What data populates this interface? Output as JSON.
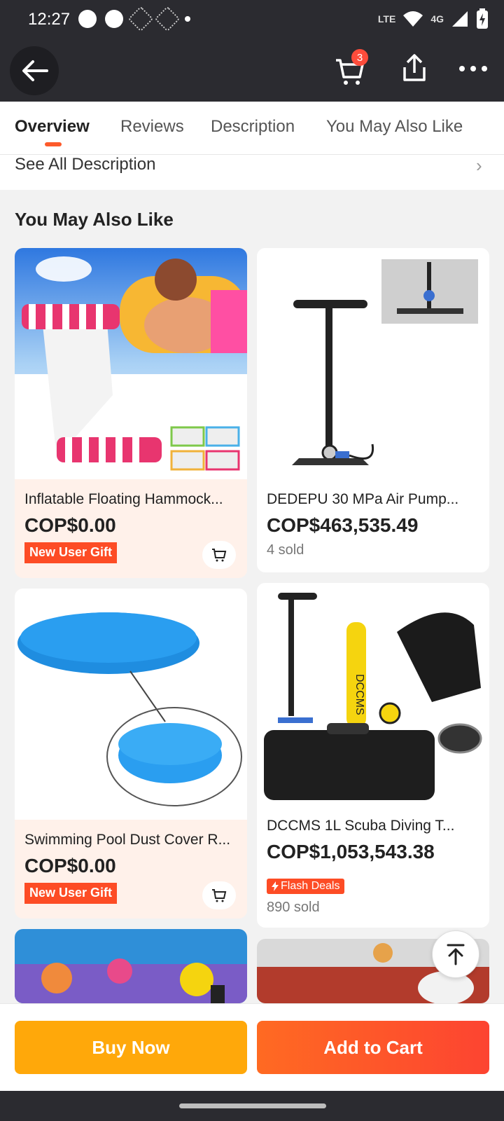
{
  "status_bar": {
    "time": "12:27",
    "network_label": "4G",
    "lte_label": "LTE"
  },
  "header": {
    "cart_count": "3"
  },
  "tabs": [
    {
      "label": "Overview",
      "active": true
    },
    {
      "label": "Reviews",
      "active": false
    },
    {
      "label": "Description",
      "active": false
    },
    {
      "label": "You May Also Like",
      "active": false
    }
  ],
  "see_all": {
    "label": "See All Description",
    "chevron": "›"
  },
  "section": {
    "title": "You May Also Like"
  },
  "products": [
    {
      "title": "Inflatable Floating Hammock...",
      "price": "COP$0.00",
      "badge": "New User Gift"
    },
    {
      "title": "DEDEPU 30 MPa Air Pump...",
      "price": "COP$463,535.49",
      "sold": "4 sold"
    },
    {
      "title": "Swimming Pool Dust Cover R...",
      "price": "COP$0.00",
      "badge": "New User Gift"
    },
    {
      "title": "DCCMS 1L Scuba Diving T...",
      "price": "COP$1,053,543.38",
      "flash": "Flash Deals",
      "sold": "890 sold",
      "brand_text": "DCCMS"
    }
  ],
  "actions": {
    "buy_now": "Buy Now",
    "add_to_cart": "Add to Cart"
  },
  "colors": {
    "accent": "#fd4c25",
    "buy": "#ffa80a",
    "bar": "#2b2b30"
  }
}
